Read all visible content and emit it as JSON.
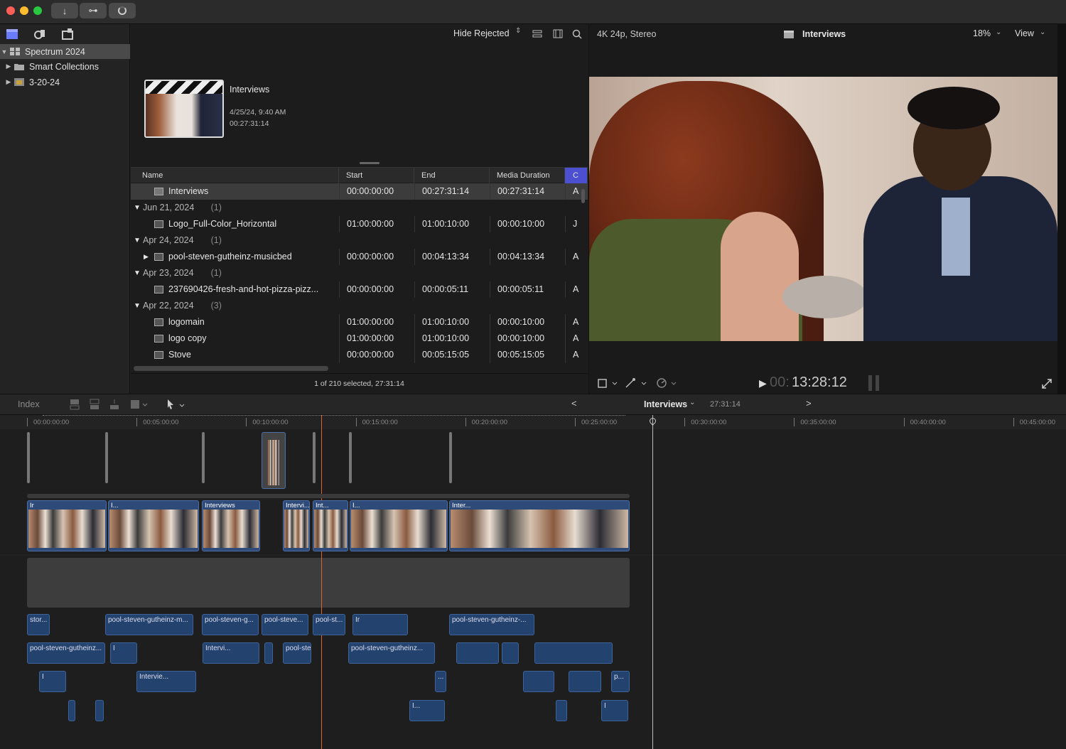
{
  "toolbar": {
    "download_icon": "↓",
    "key_icon": "⊶",
    "record_icon": "●"
  },
  "library": {
    "items": [
      {
        "label": "Spectrum 2024",
        "expanded": true,
        "selected": true
      },
      {
        "label": "Smart Collections",
        "expanded": false
      },
      {
        "label": "3-20-24",
        "expanded": false
      }
    ]
  },
  "browser": {
    "filter": "Hide Rejected",
    "project": {
      "name": "Interviews",
      "date": "4/25/24, 9:40 AM",
      "duration": "00:27:31:14"
    },
    "columns": [
      "Name",
      "Start",
      "End",
      "Media Duration",
      "C"
    ],
    "rows": [
      {
        "type": "item",
        "name": "Interviews",
        "start": "00:00:00:00",
        "end": "00:27:31:14",
        "dur": "00:27:31:14",
        "c": "A",
        "selected": true
      },
      {
        "type": "group",
        "name": "Jun 21, 2024",
        "count": "(1)"
      },
      {
        "type": "item",
        "name": "Logo_Full-Color_Horizontal",
        "start": "01:00:00:00",
        "end": "01:00:10:00",
        "dur": "00:00:10:00",
        "c": "J"
      },
      {
        "type": "group",
        "name": "Apr 24, 2024",
        "count": "(1)"
      },
      {
        "type": "item",
        "name": "pool-steven-gutheinz-musicbed",
        "start": "00:00:00:00",
        "end": "00:04:13:34",
        "dur": "00:04:13:34",
        "c": "A",
        "expandable": true
      },
      {
        "type": "group",
        "name": "Apr 23, 2024",
        "count": "(1)"
      },
      {
        "type": "item",
        "name": "237690426-fresh-and-hot-pizza-pizz...",
        "start": "00:00:00:00",
        "end": "00:00:05:11",
        "dur": "00:00:05:11",
        "c": "A"
      },
      {
        "type": "group",
        "name": "Apr 22, 2024",
        "count": "(3)"
      },
      {
        "type": "item",
        "name": "logomain",
        "start": "01:00:00:00",
        "end": "01:00:10:00",
        "dur": "00:00:10:00",
        "c": "A"
      },
      {
        "type": "item",
        "name": "logo copy",
        "start": "01:00:00:00",
        "end": "01:00:10:00",
        "dur": "00:00:10:00",
        "c": "A"
      },
      {
        "type": "item",
        "name": "Stove",
        "start": "00:00:00:00",
        "end": "00:05:15:05",
        "dur": "00:05:15:05",
        "c": "A"
      }
    ],
    "status": "1 of 210 selected, 27:31:14"
  },
  "viewer": {
    "format": "4K 24p, Stereo",
    "title": "Interviews",
    "zoom": "18%",
    "view_label": "View",
    "timecode_dim": "00:",
    "timecode": "13:28:12"
  },
  "timeline": {
    "index_label": "Index",
    "project": "Interviews",
    "duration": "27:31:14",
    "ruler": [
      "00:00:00:00",
      "00:05:00:00",
      "00:10:00:00",
      "00:15:00:00",
      "00:20:00:00",
      "00:25:00:00",
      "00:30:00:00",
      "00:35:00:00",
      "00:40:00:00",
      "00:45:00:00"
    ],
    "clip_labels": [
      "Ir",
      "I...",
      "Interviews",
      "Intervi...",
      "Int...",
      "I...",
      "Inter...",
      "Ir",
      "I",
      "I"
    ],
    "audio_row1": [
      "stor...",
      "pool-steven-gutheinz-m...",
      "pool-steven-g...",
      "pool-steve...",
      "pool-st...",
      "Ir",
      "pool-steven-gutheinz-..."
    ],
    "audio_row2": [
      "pool-steven-gutheinz...",
      "I",
      "Intervi...",
      "pool-steven-gutheinz-...",
      "pool-steven-gutheinz..."
    ],
    "audio_row3": [
      "I",
      "Intervie...",
      "...",
      "p..."
    ],
    "audio_row4": [
      "I...",
      "I"
    ]
  },
  "colors": {
    "accent": "#6a7bff",
    "clip": "#2e4a78",
    "playhead": "#d9603a"
  }
}
